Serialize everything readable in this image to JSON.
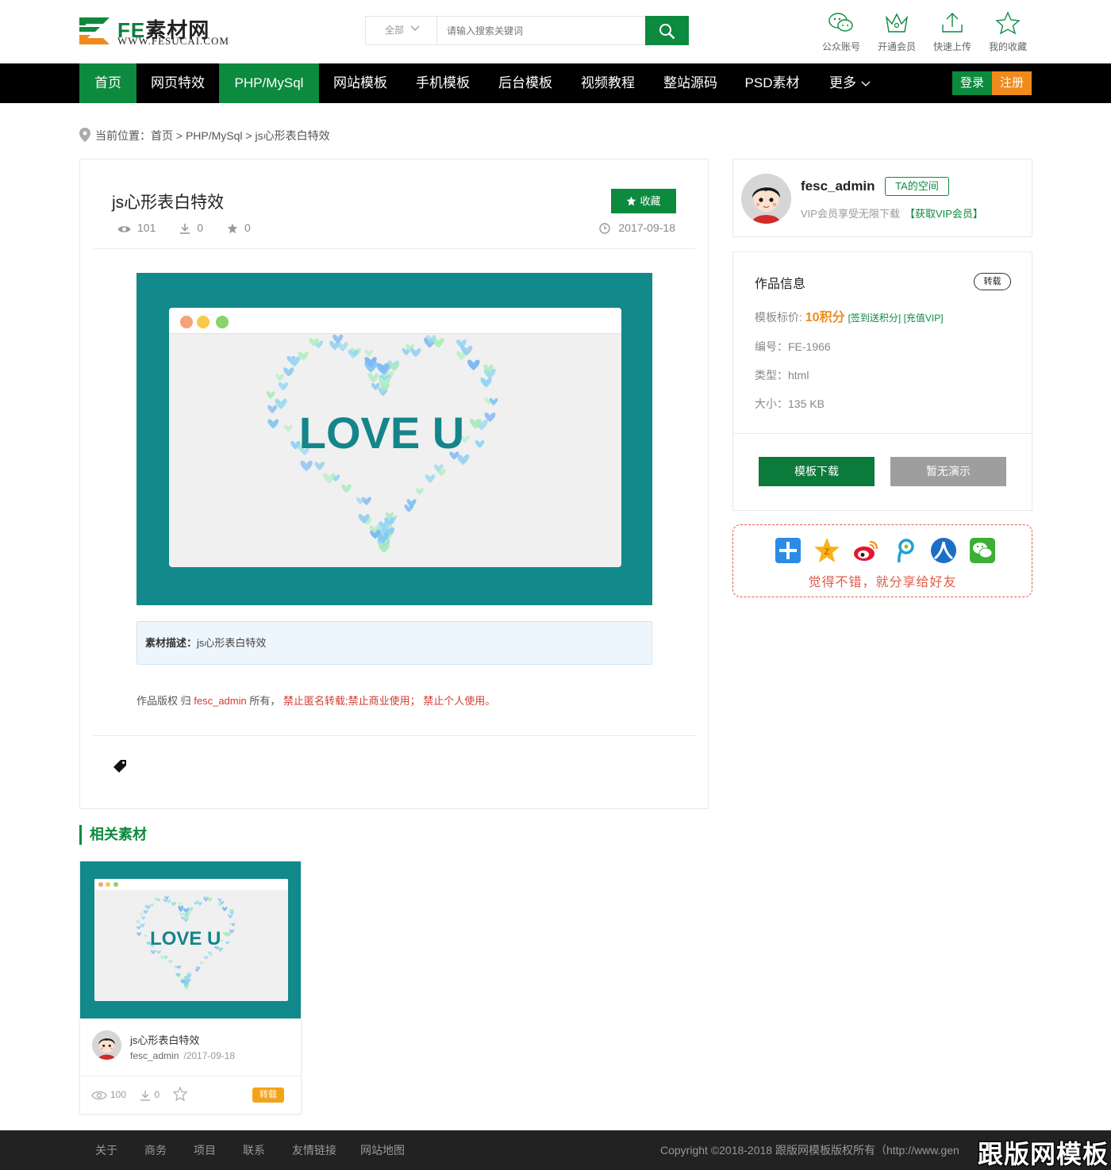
{
  "header": {
    "logo_fe": "FE",
    "logo_cn": "素材网",
    "logo_url": "WWW.FESUCAI.COM",
    "search_category": "全部",
    "search_placeholder": "请输入搜索关键词",
    "icons": [
      {
        "icon": "wechat-icon",
        "label": "公众账号"
      },
      {
        "icon": "crown-icon",
        "label": "开通会员"
      },
      {
        "icon": "upload-icon",
        "label": "快速上传"
      },
      {
        "icon": "star-icon",
        "label": "我的收藏"
      }
    ]
  },
  "nav": {
    "items": [
      "首页",
      "网页特效",
      "PHP/MySql",
      "网站模板",
      "手机模板",
      "后台模板",
      "视频教程",
      "整站源码",
      "PSD素材",
      "更多"
    ],
    "login": "登录",
    "register": "注册"
  },
  "breadcrumb": "当前位置：首页 > PHP/MySql > js心形表白特效",
  "post": {
    "title": "js心形表白特效",
    "favorite_label": "收藏",
    "views": "101",
    "downloads": "0",
    "stars": "0",
    "date": "2017-09-18",
    "preview_text": "LOVE U",
    "desc_label": "素材描述：",
    "desc_text": "js心形表白特效",
    "copyright_prefix": "作品版权 归",
    "copyright_owner": "fesc_admin",
    "copyright_mid": "所有，",
    "copyright_rules": "禁止匿名转载;禁止商业使用； 禁止个人使用。"
  },
  "author": {
    "name": "fesc_admin",
    "space_label": "TA的空间",
    "vip_text": "VIP会员享受无限下载",
    "vip_link": "【获取VIP会员】"
  },
  "info": {
    "title": "作品信息",
    "badge": "转载",
    "price_label": "模板标价:",
    "price": "10积分",
    "price_links": "[签到送积分] [充值VIP]",
    "code": "编号：FE-1966",
    "type": "类型：html",
    "size": "大小：135 KB",
    "download_label": "模板下载",
    "demo_label": "暂无演示"
  },
  "share": {
    "icons": [
      "share-plus-icon",
      "qzone-icon",
      "weibo-icon",
      "tencent-weibo-icon",
      "renren-icon",
      "wechat-share-icon"
    ],
    "text": "觉得不错，就分享给好友"
  },
  "related": {
    "heading": "相关素材",
    "items": [
      {
        "title": "js心形表白特效",
        "author": "fesc_admin",
        "date": "/2017-09-18",
        "views": "100",
        "downloads": "0",
        "badge": "转载",
        "preview_text": "LOVE U"
      }
    ]
  },
  "footer": {
    "links": [
      "关于",
      "商务",
      "项目",
      "联系",
      "友情链接",
      "网站地图"
    ],
    "copyright": "Copyright ©2018-2018 跟版网模板版权所有（http://www.gen",
    "watermark": "跟版网模板"
  },
  "colors": {
    "brand_green": "#0c8a3e",
    "accent_orange": "#f08a1c",
    "preview_teal": "#12898a",
    "share_red": "#e05a47"
  }
}
